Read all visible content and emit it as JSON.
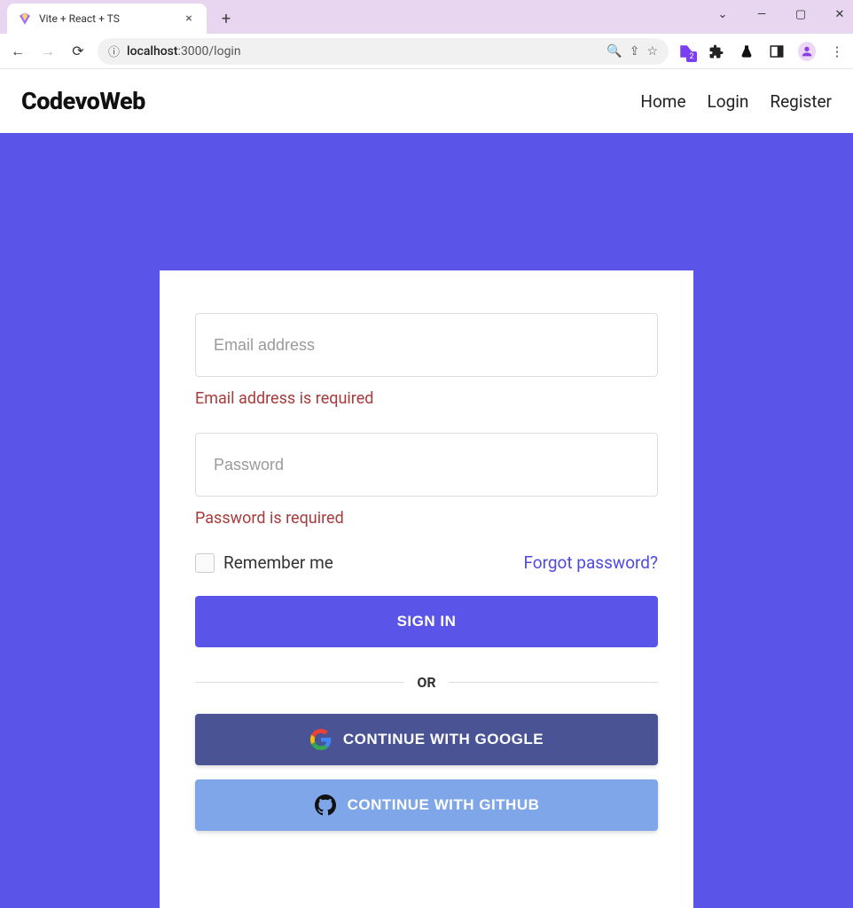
{
  "browser": {
    "tab_title": "Vite + React + TS",
    "url_host": "localhost",
    "url_path": ":3000/login",
    "ext_badge": "2"
  },
  "header": {
    "logo": "CodevoWeb",
    "nav": {
      "home": "Home",
      "login": "Login",
      "register": "Register"
    }
  },
  "form": {
    "email_placeholder": "Email address",
    "email_value": "",
    "email_error": "Email address is required",
    "password_placeholder": "Password",
    "password_value": "",
    "password_error": "Password is required",
    "remember_label": "Remember me",
    "forgot_label": "Forgot password?",
    "submit_label": "SIGN IN",
    "divider": "OR",
    "google_label": "CONTINUE WITH GOOGLE",
    "github_label": "CONTINUE WITH GITHUB"
  }
}
